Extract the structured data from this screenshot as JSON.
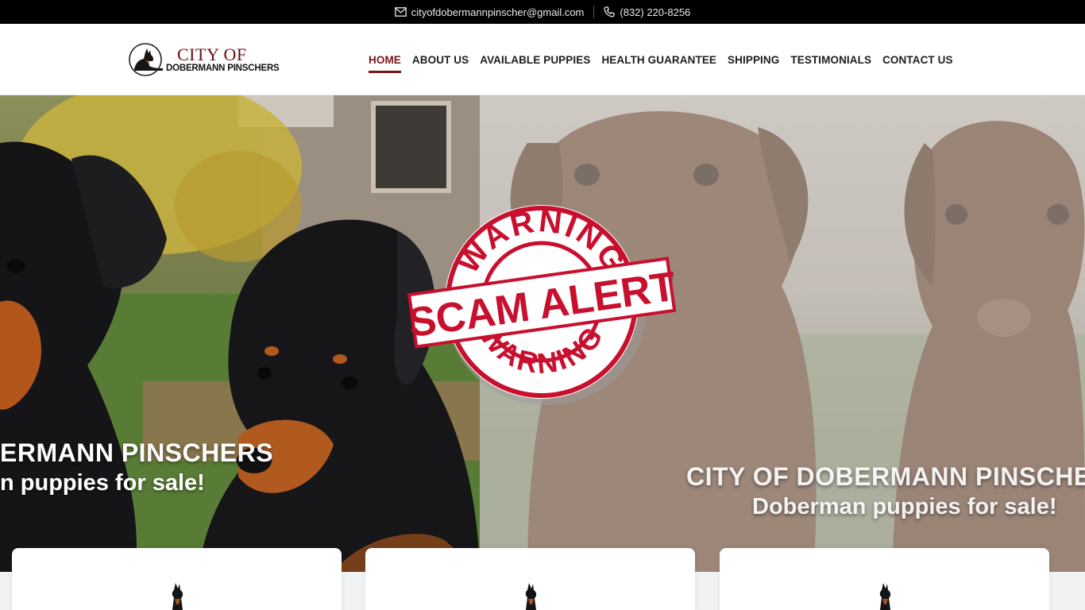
{
  "topbar": {
    "email": "cityofdobermannpinscher@gmail.com",
    "phone": "(832) 220-8256",
    "email_icon": "mail-icon",
    "phone_icon": "phone-icon"
  },
  "logo": {
    "line1": "CITY OF",
    "line2": "DOBERMANN PINSCHERS"
  },
  "nav": {
    "items": [
      "HOME",
      "ABOUT US",
      "AVAILABLE PUPPIES",
      "HEALTH GUARANTEE",
      "SHIPPING",
      "TESTIMONIALS",
      "CONTACT US"
    ],
    "active": "HOME"
  },
  "hero": {
    "slide_left": {
      "title": "ERMANN PINSCHERS",
      "subtitle": "n puppies for sale!"
    },
    "slide_right": {
      "title": "CITY OF DOBERMANN PINSCHE",
      "subtitle": "Doberman puppies for sale!"
    },
    "stamp": {
      "top_text": "WARNING",
      "banner_text": "SCAM ALERT",
      "bottom_text": "WARNING",
      "color": "#c8102e"
    }
  },
  "colors": {
    "brand": "#7a1317",
    "topbar_bg": "#000000"
  }
}
